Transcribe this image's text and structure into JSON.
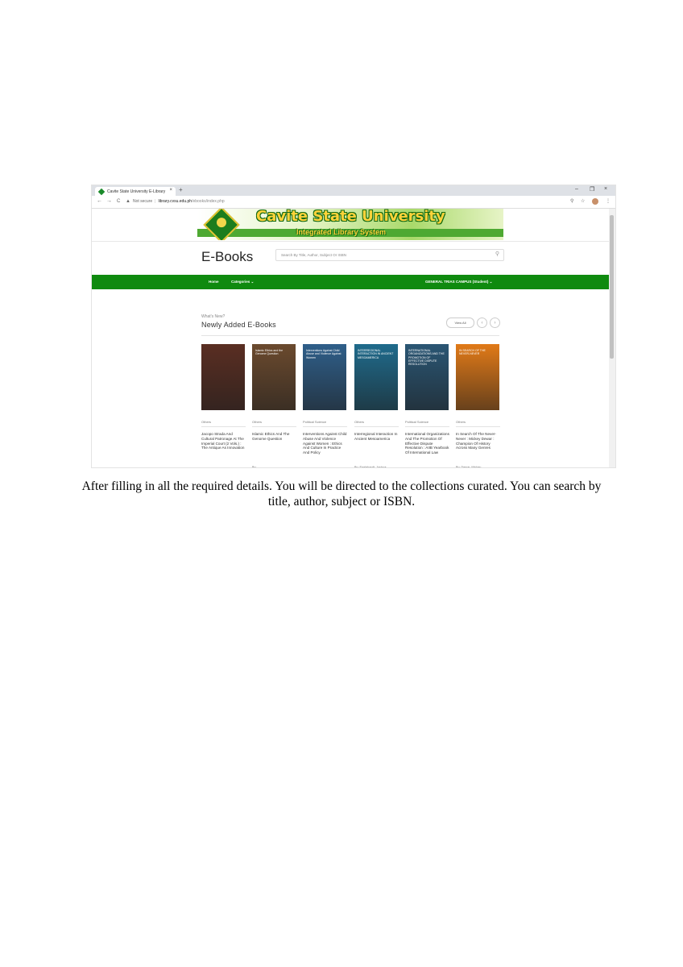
{
  "browser": {
    "tab_title": "Cavite State University E-Library",
    "tab_close": "×",
    "new_tab": "+",
    "url_security": "Not secure",
    "url_separator": "|",
    "url_host": "library.cvsu.edu.ph",
    "url_path": "/ebooks/index.php",
    "nav_back": "←",
    "nav_forward": "→",
    "nav_reload": "C",
    "zoom_icon": "⚲",
    "star_icon": "☆",
    "menu_icon": "⋮",
    "win_minimize": "–",
    "win_restore": "❐",
    "win_close": "×"
  },
  "header": {
    "university_name": "Cavite State University",
    "system_name": "Integrated Library System"
  },
  "page": {
    "heading": "E-Books",
    "search_placeholder": "Search By Title, Author, Subject Or ISBN"
  },
  "nav": {
    "home": "Home",
    "categories": "Categories  ⌄",
    "campus": "GENERAL TRIAS CAMPUS (Student)  ⌄"
  },
  "section": {
    "kicker": "What's New?",
    "title": "Newly Added E-Books",
    "view_all": "View All",
    "prev": "‹",
    "next": "›"
  },
  "books": [
    {
      "category": "Others",
      "title": "Jacopo Strada And Cultural Patronage At The Imperial Court (2 Vols.) : The Antique As Innovation",
      "author": "",
      "cover_text": "",
      "cover_color": "#5a2e22"
    },
    {
      "category": "Others",
      "title": "Islamic Ethics And The Genome Question",
      "author": "By:",
      "cover_text": "Islamic Ethics and the Genome Question",
      "cover_color": "#6b4a2e"
    },
    {
      "category": "Political Science",
      "title": "Interventions Against Child Abuse And Violence Against Women : Ethics And Culture In Practice And Policy",
      "author": "",
      "cover_text": "Interventions Against Child Abuse and Violence Against Women",
      "cover_color": "#2f5f8a"
    },
    {
      "category": "Others",
      "title": "Interregional Interaction In Ancient Mesoamerica",
      "author": "By: Englehardt, Joshua; Carrasco, Michael D.",
      "cover_text": "INTERREGIONAL INTERACTION IN ANCIENT MESOAMERICA",
      "cover_color": "#1f6b8c"
    },
    {
      "category": "Political Science",
      "title": "International Organizations And The Promotion Of Effective Dispute Resolution : AIIB Yearbook Of International Law",
      "author": "",
      "cover_text": "INTERNATIONAL ORGANIZATIONS AND THE PROMOTION OF EFFECTIVE DISPUTE RESOLUTION",
      "cover_color": "#2a5674"
    },
    {
      "category": "Others",
      "title": "In Search Of The Never-Never : Mickey Dewar : Champion Of History Across Many Genres",
      "author": "By: Dewar, Mickey",
      "cover_text": "IN SEARCH OF THE NEVER-NEVER",
      "cover_color": "#e17a18"
    }
  ],
  "caption": "After filling in all the required details. You will be directed to the collections curated. You can search by title, author, subject or ISBN."
}
